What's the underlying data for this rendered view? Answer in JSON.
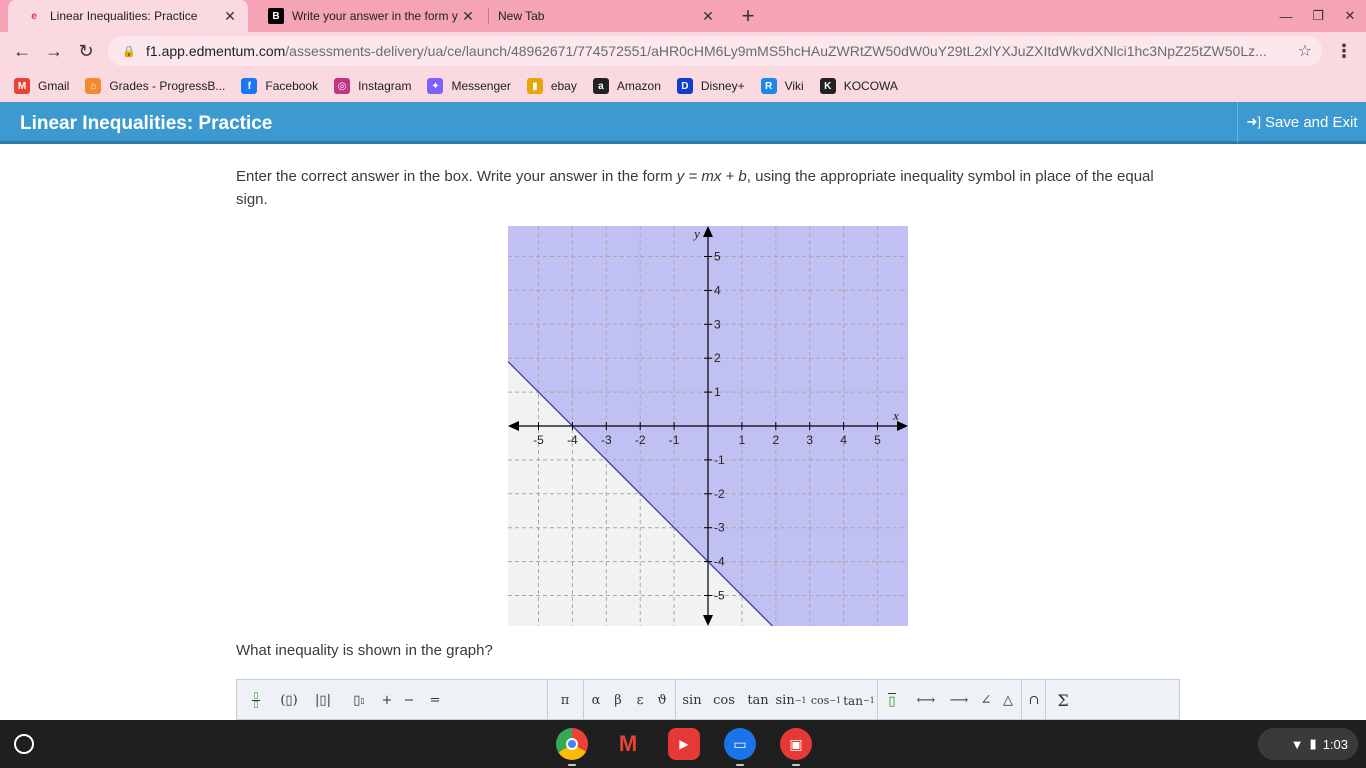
{
  "browser": {
    "tabs": [
      {
        "title": "Linear Inequalities: Practice",
        "favicon": "edmentum-icon",
        "active": true
      },
      {
        "title": "Write your answer in the form y =",
        "favicon": "brainly-icon",
        "active": false
      },
      {
        "title": "New Tab",
        "favicon": "",
        "active": false
      }
    ],
    "url_host": "f1.app.edmentum.com",
    "url_path": "/assessments-delivery/ua/ce/launch/48962671/774572551/aHR0cHM6Ly9mMS5hcHAuZWRtZW50dW0uY29tL2xlYXJuZXItdWkvdXNlci1hc3NpZ25tZW50Lz...",
    "bookmarks": [
      {
        "label": "Gmail",
        "icon": "gmail-icon",
        "color": "#ea4335"
      },
      {
        "label": "Grades - ProgressB...",
        "icon": "grades-icon",
        "color": "#f28b30"
      },
      {
        "label": "Facebook",
        "icon": "facebook-icon",
        "color": "#1877f2"
      },
      {
        "label": "Instagram",
        "icon": "instagram-icon",
        "color": "#c13584"
      },
      {
        "label": "Messenger",
        "icon": "messenger-icon",
        "color": "#7b61ff"
      },
      {
        "label": "ebay",
        "icon": "ebay-icon",
        "color": "#e8a50b"
      },
      {
        "label": "Amazon",
        "icon": "amazon-icon",
        "color": "#222222"
      },
      {
        "label": "Disney+",
        "icon": "disney-icon",
        "color": "#113ccf"
      },
      {
        "label": "Viki",
        "icon": "viki-icon",
        "color": "#1e88e5"
      },
      {
        "label": "KOCOWA",
        "icon": "kocowa-icon",
        "color": "#222222"
      }
    ]
  },
  "app": {
    "title": "Linear Inequalities: Practice",
    "save_exit_label": "Save and Exit",
    "header_color": "#3d9ad1"
  },
  "content": {
    "instruction_a": "Enter the correct answer in the box. Write your answer in the form ",
    "instruction_form": "y = mx + b",
    "instruction_b": ", using the appropriate inequality symbol in place of the equal sign.",
    "question": "What inequality is shown in the graph?"
  },
  "chart_data": {
    "type": "line",
    "xlabel": "x",
    "ylabel": "y",
    "xlim": [
      -5.9,
      5.9
    ],
    "ylim": [
      -5.9,
      5.9
    ],
    "x_ticks": [
      -5,
      -4,
      -3,
      -2,
      -1,
      1,
      2,
      3,
      4,
      5
    ],
    "y_ticks": [
      5,
      4,
      3,
      2,
      1,
      -1,
      -2,
      -3,
      -4,
      -5
    ],
    "grid": true,
    "line": {
      "slope": -1,
      "intercept": -4,
      "style": "solid"
    },
    "shaded_region": "above",
    "colors": {
      "shade": "#c0c0f2",
      "unshaded": "#f2f2f2",
      "line": "#3b3bb0",
      "grid": "#a8a8a8"
    }
  },
  "math_toolbar": {
    "buttons": [
      "π",
      "α",
      "β",
      "ε",
      "ϑ",
      "sin",
      "cos",
      "tan",
      "+",
      "−",
      "=",
      "∠",
      "△",
      "∩",
      "Σ"
    ],
    "inverse_trig": {
      "sin": "sin",
      "cos": "cos",
      "tan": "tan",
      "exp": "−1"
    }
  },
  "system": {
    "time": "1:03"
  }
}
